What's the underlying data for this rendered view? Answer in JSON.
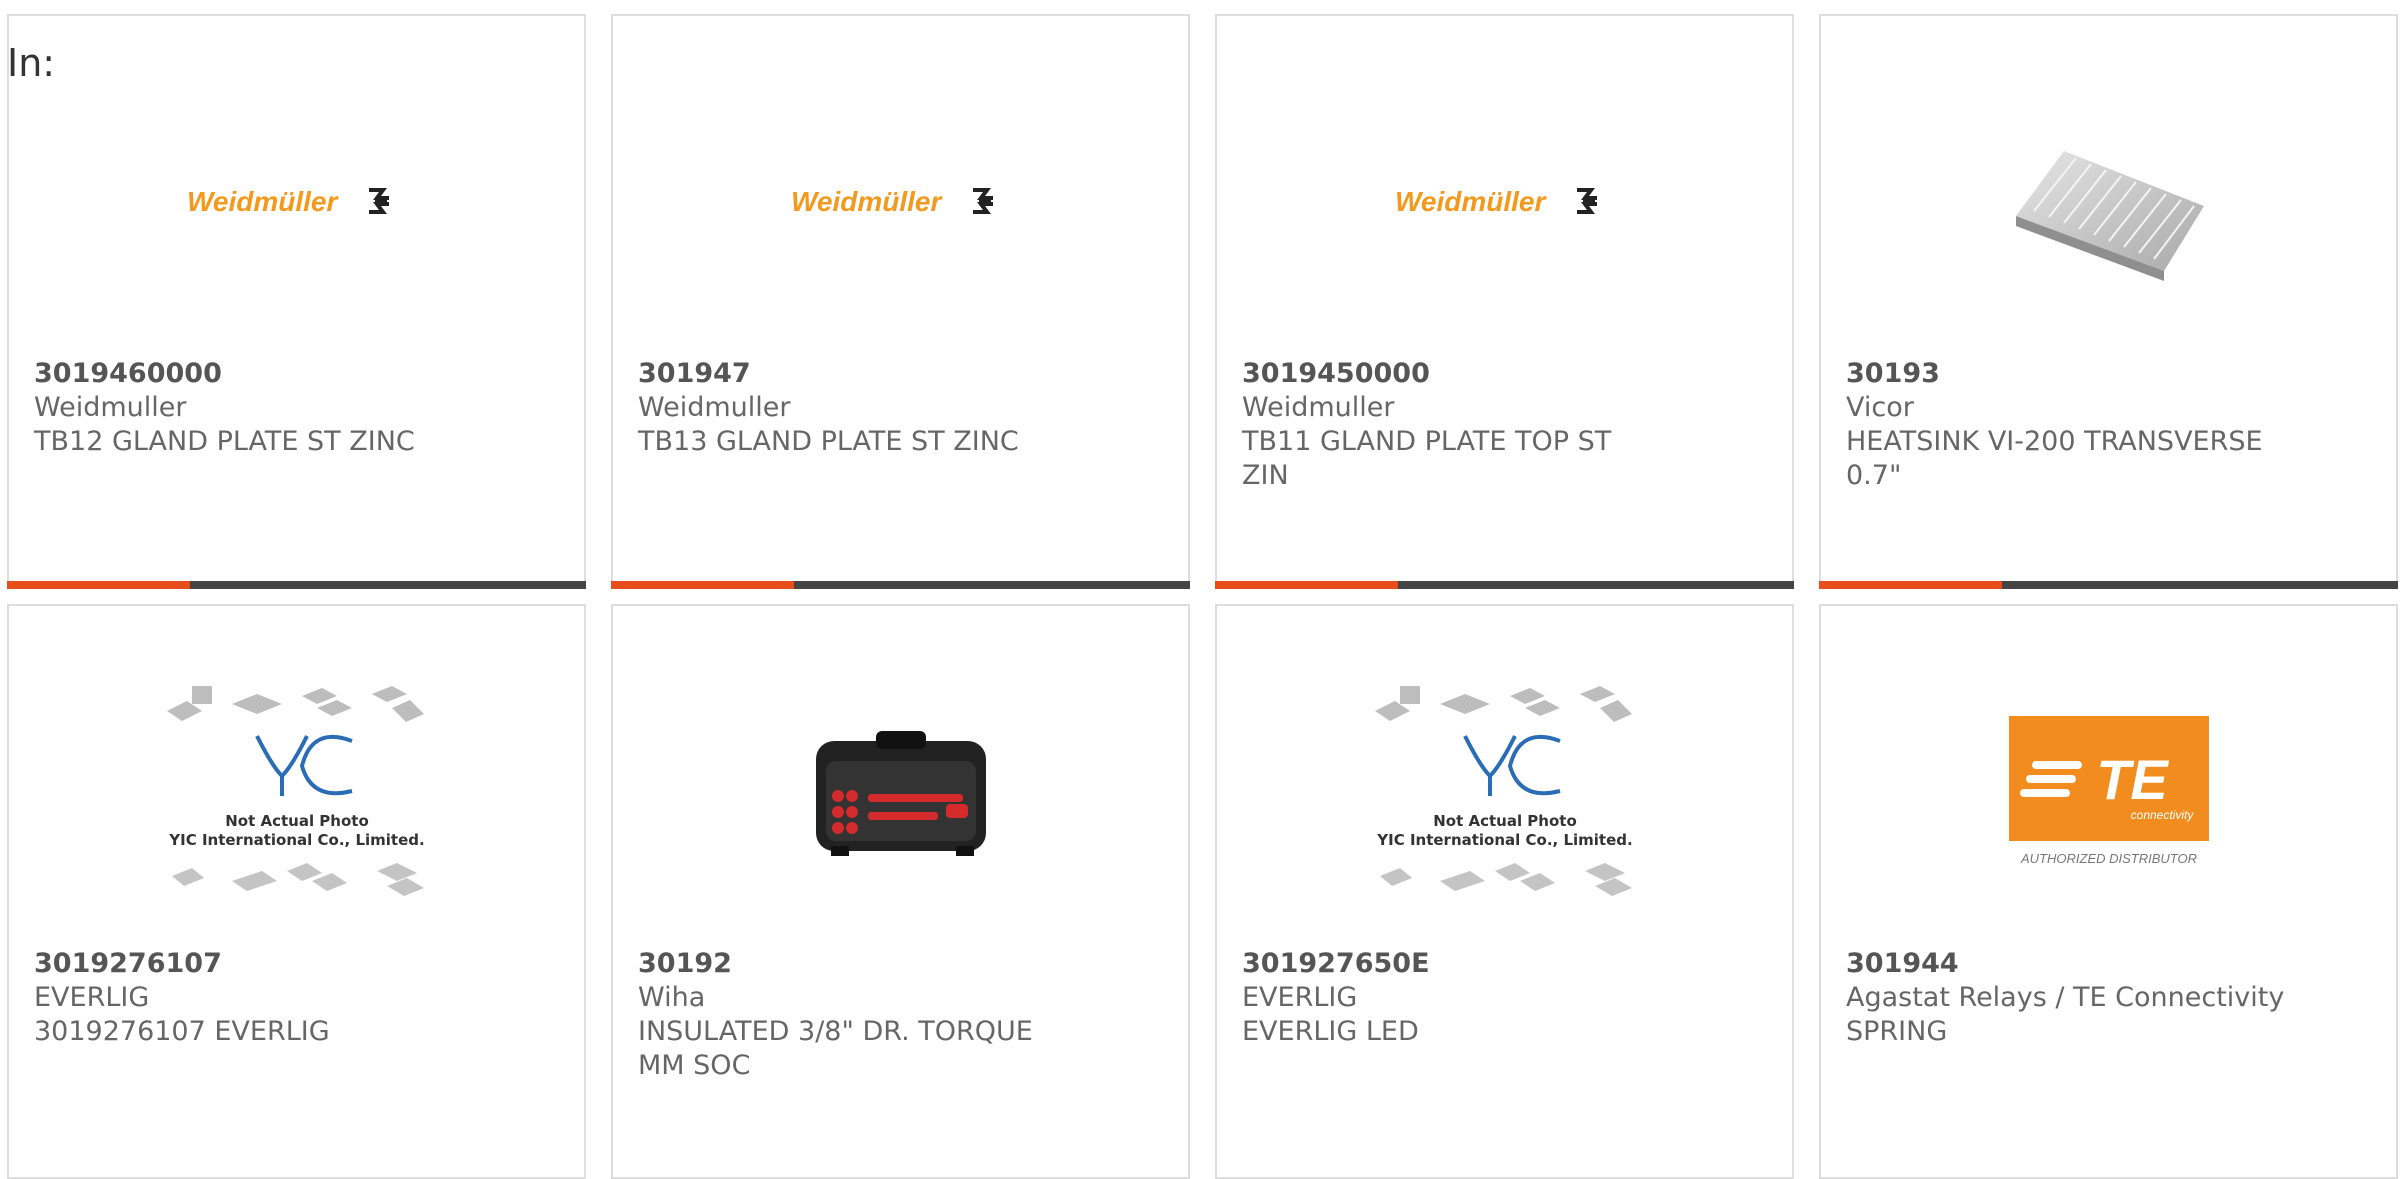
{
  "search": {
    "label": "In:"
  },
  "products": [
    {
      "part": "3019460000",
      "manufacturer": "Weidmuller",
      "description": "TB12 GLAND PLATE ST ZINC",
      "image": "weidmuller-logo"
    },
    {
      "part": "301947",
      "manufacturer": "Weidmuller",
      "description": "TB13 GLAND PLATE ST ZINC",
      "image": "weidmuller-logo"
    },
    {
      "part": "3019450000",
      "manufacturer": "Weidmuller",
      "description": "TB11 GLAND PLATE TOP ST ZIN",
      "image": "weidmuller-logo"
    },
    {
      "part": "30193",
      "manufacturer": "Vicor",
      "description": "HEATSINK VI-200 TRANSVERSE 0.7\"",
      "image": "heatsink-photo"
    },
    {
      "part": "3019276107",
      "manufacturer": "EVERLIG",
      "description": "3019276107 EVERLIG",
      "image": "yic-placeholder"
    },
    {
      "part": "30192",
      "manufacturer": "Wiha",
      "description": "INSULATED 3/8\" DR. TORQUE MM SOC",
      "image": "toolkit-photo"
    },
    {
      "part": "301927650E",
      "manufacturer": "EVERLIG",
      "description": "EVERLIG LED",
      "image": "yic-placeholder"
    },
    {
      "part": "301944",
      "manufacturer": "Agastat Relays / TE Connectivity",
      "description": "SPRING",
      "image": "te-logo"
    }
  ],
  "logos": {
    "weidmuller": "Weidmüller",
    "yic_line1": "Not Actual Photo",
    "yic_line2": "YIC International Co., Limited.",
    "te_sub": "connectivity",
    "te_footer": "AUTHORIZED DISTRIBUTOR"
  },
  "colors": {
    "accent": "#e84e1b",
    "bar": "#444444",
    "weidmuller_orange": "#f39a1e",
    "te_orange": "#f28c1e",
    "yic_blue": "#2a6db5"
  }
}
